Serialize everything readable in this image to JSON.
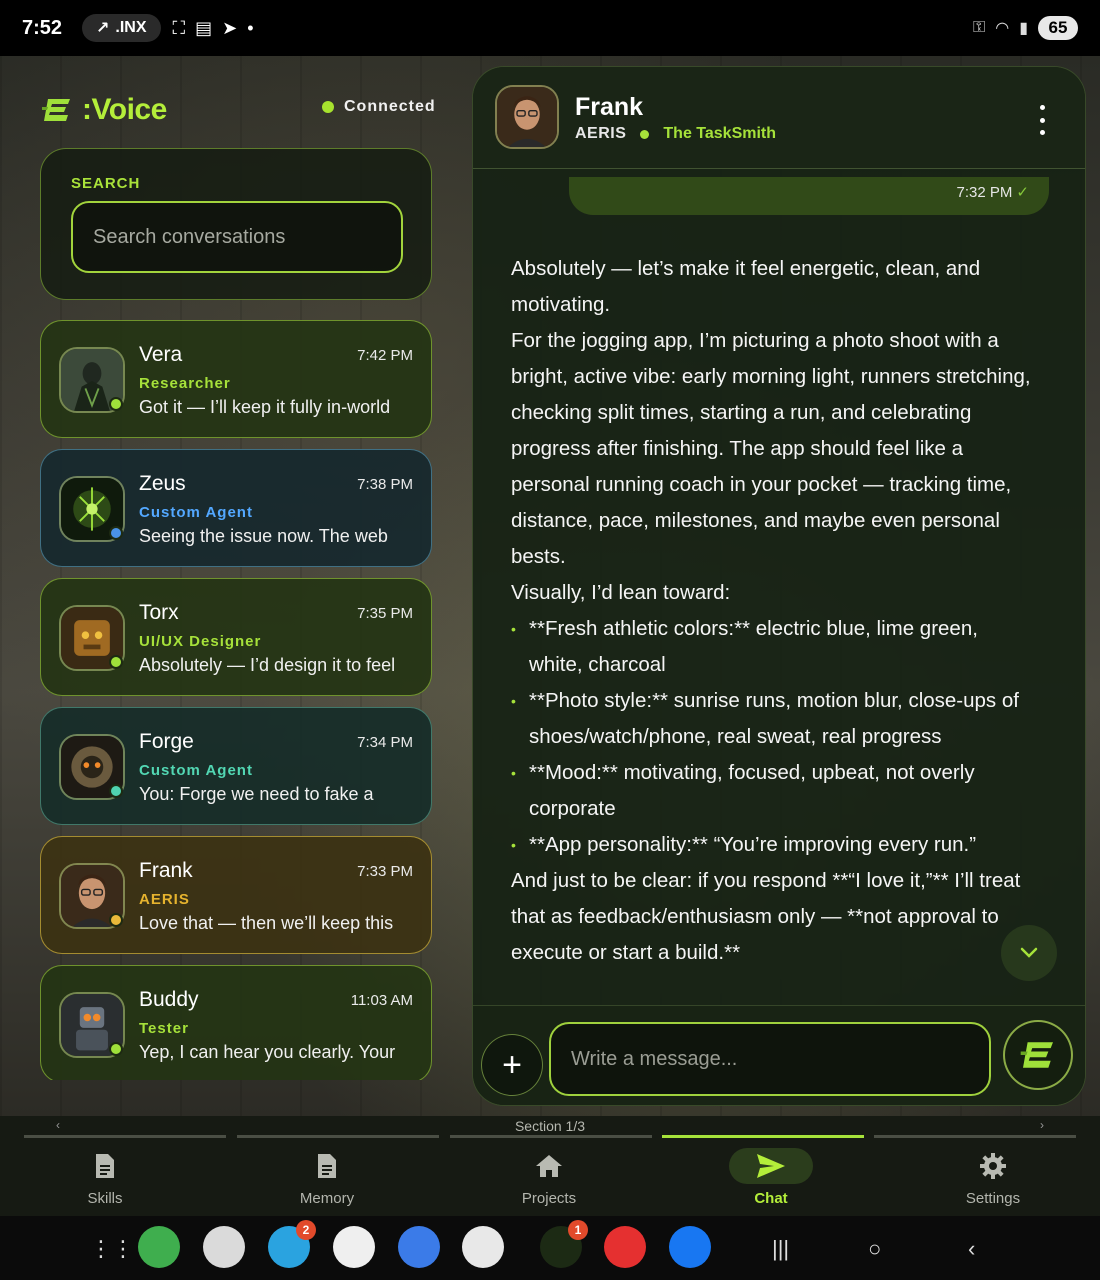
{
  "status_bar": {
    "time": "7:52",
    "ticker": ".INX",
    "battery": "65"
  },
  "sidebar": {
    "brand": ":Voice",
    "connection": "Connected",
    "search_label": "SEARCH",
    "search_placeholder": "Search conversations",
    "conversations": [
      {
        "name": "Vera",
        "time": "7:42 PM",
        "role": "Researcher",
        "preview": "Got it — I’ll keep it fully in-world",
        "theme": "green"
      },
      {
        "name": "Zeus",
        "time": "7:38 PM",
        "role": "Custom Agent",
        "preview": "Seeing the issue now. The web",
        "theme": "blue"
      },
      {
        "name": "Torx",
        "time": "7:35 PM",
        "role": "UI/UX Designer",
        "preview": "Absolutely — I’d design it to feel",
        "theme": "green"
      },
      {
        "name": "Forge",
        "time": "7:34 PM",
        "role": "Custom Agent",
        "preview": "You: Forge we need to fake a",
        "theme": "teal"
      },
      {
        "name": "Frank",
        "time": "7:33 PM",
        "role": "AERIS",
        "preview": "Love that — then we’ll keep this",
        "theme": "amber"
      },
      {
        "name": "Buddy",
        "time": "11:03 AM",
        "role": "Tester",
        "preview": "Yep, I can hear you clearly. Your",
        "theme": "green"
      }
    ]
  },
  "chat": {
    "contact_name": "Frank",
    "contact_org": "AERIS",
    "contact_tag": "The TaskSmith",
    "last_sent_time": "7:32 PM",
    "message": {
      "p1": "Absolutely — let’s make it feel energetic, clean, and motivating.",
      "p2": "For the jogging app, I’m picturing a photo shoot with a bright, active vibe: early morning light, runners stretching, checking split times, starting a run, and celebrating progress after finishing. The app should feel like a personal running coach in your pocket — tracking time, distance, pace, milestones, and maybe even personal bests.",
      "p3": "Visually, I’d lean toward:",
      "bullets": [
        "**Fresh athletic colors:** electric blue, lime green, white, charcoal",
        "**Photo style:** sunrise runs, motion blur, close-ups of shoes/watch/phone, real sweat, real progress",
        "**Mood:** motivating, focused, upbeat, not overly corporate",
        "**App personality:** “You’re improving every run.”"
      ],
      "p4": "And just to be clear: if you respond **“I love it,”** I’ll treat that as feedback/enthusiasm only — **not approval to execute or start a build.**"
    },
    "composer_placeholder": "Write a message..."
  },
  "bottom_nav": {
    "section": "Section 1/3",
    "items": [
      {
        "label": "Skills",
        "icon": "document-icon"
      },
      {
        "label": "Memory",
        "icon": "document-icon"
      },
      {
        "label": "Projects",
        "icon": "home-icon"
      },
      {
        "label": "Chat",
        "icon": "send-icon",
        "active": true
      },
      {
        "label": "Settings",
        "icon": "gear-icon"
      }
    ]
  },
  "dock": {
    "telegram_badge": "2",
    "voice_badge": "1"
  },
  "colors": {
    "accent": "#a6e23a",
    "blue_role": "#53a8ff",
    "teal_role": "#52d7b3",
    "amber_role": "#e6b32e"
  }
}
